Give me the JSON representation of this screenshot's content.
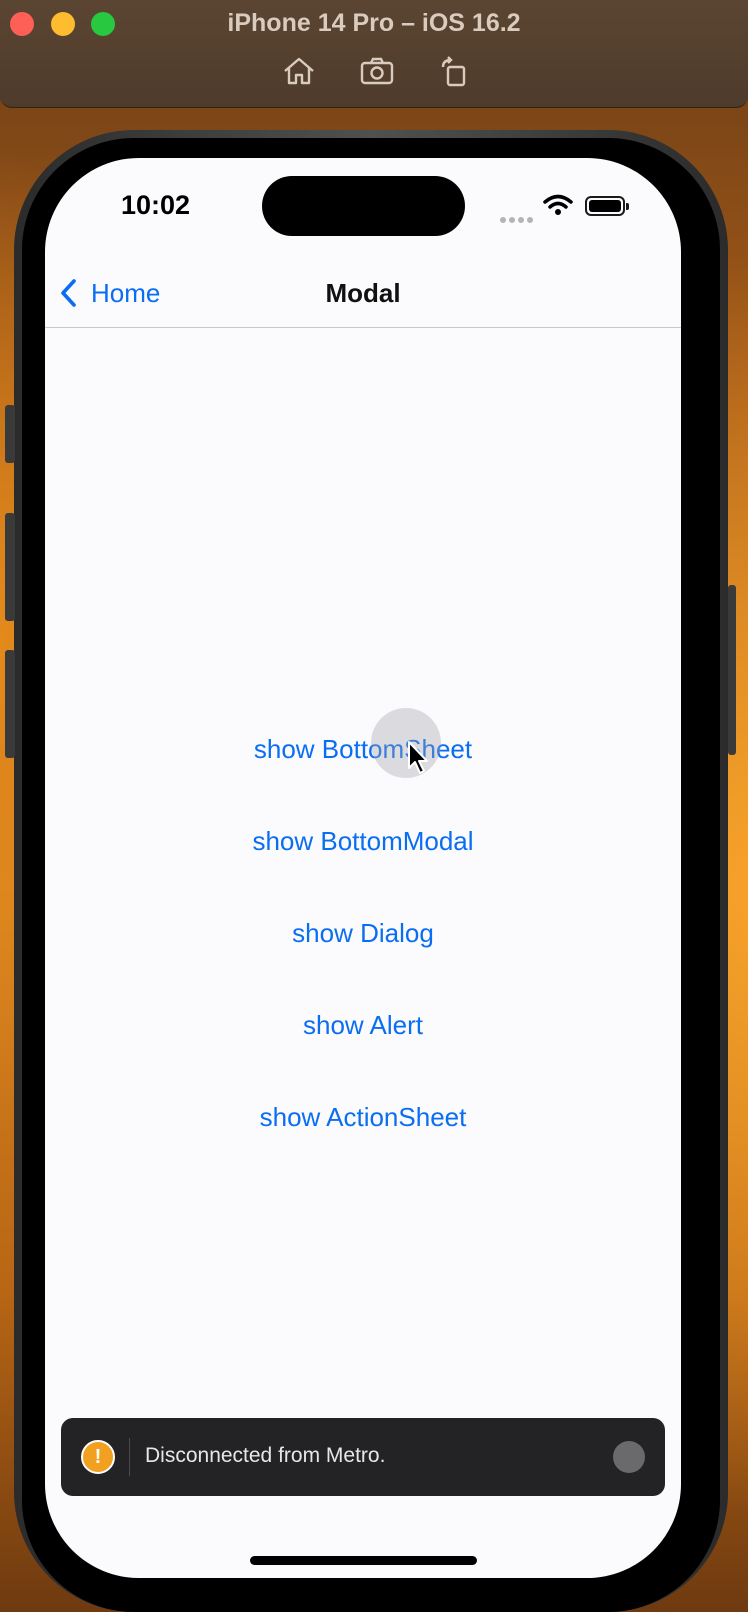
{
  "window": {
    "title": "iPhone 14 Pro – iOS 16.2",
    "toolbar_icons": [
      "home-icon",
      "screenshot-icon",
      "rotate-icon"
    ]
  },
  "status_bar": {
    "time": "10:02"
  },
  "nav": {
    "back_label": "Home",
    "title": "Modal"
  },
  "actions": [
    {
      "label": "show BottomSheet"
    },
    {
      "label": "show BottomModal"
    },
    {
      "label": "show Dialog"
    },
    {
      "label": "show Alert"
    },
    {
      "label": "show ActionSheet"
    }
  ],
  "toast": {
    "icon": "warning-icon",
    "message": "Disconnected from Metro."
  },
  "colors": {
    "link": "#0a6ef2",
    "toast_bg": "#232326",
    "warning": "#f2a01f"
  }
}
